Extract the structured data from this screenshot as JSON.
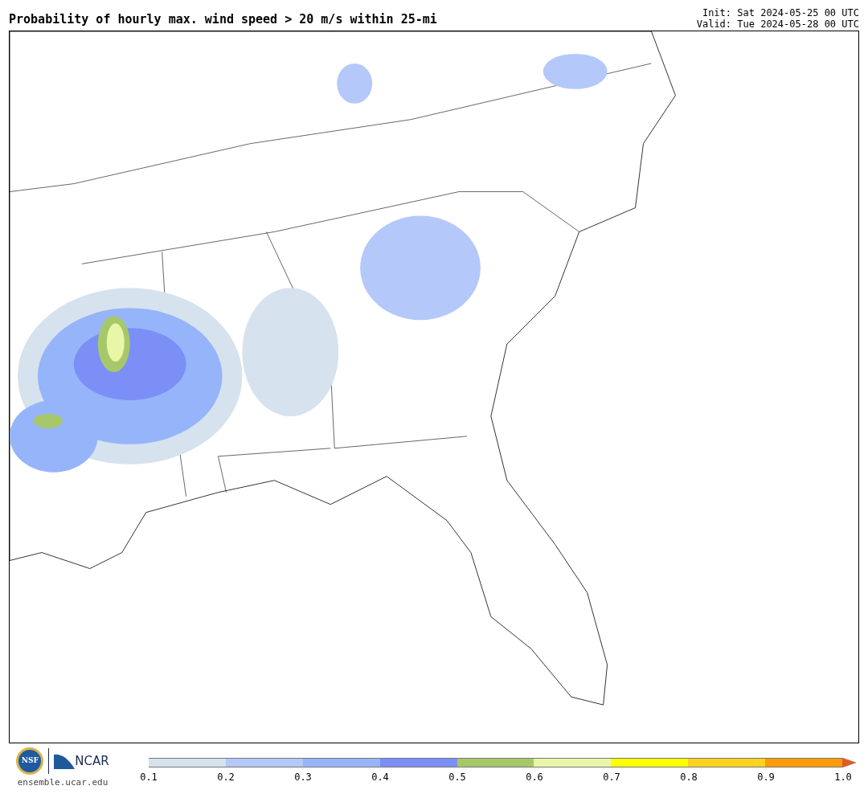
{
  "title": "Probability of hourly max. wind speed > 20 m/s within 25-mi",
  "init": "Init: Sat 2024-05-25 00 UTC",
  "valid": "Valid: Tue 2024-05-28 00 UTC",
  "logos": {
    "nsf": "NSF",
    "ncar": "NCAR",
    "url": "ensemble.ucar.edu"
  },
  "colorbar": {
    "segments": [
      {
        "color": "#d6e2ed"
      },
      {
        "color": "#b4c8fa"
      },
      {
        "color": "#96b4fa"
      },
      {
        "color": "#7b8ff7"
      },
      {
        "color": "#a7c868"
      },
      {
        "color": "#e8f6a8"
      },
      {
        "color": "#ffff00"
      },
      {
        "color": "#ffd21e"
      },
      {
        "color": "#ff9b0a"
      }
    ],
    "extend": {
      "color": "#e8581a"
    },
    "ticks": [
      "0.1",
      "0.2",
      "0.3",
      "0.4",
      "0.5",
      "0.6",
      "0.7",
      "0.8",
      "0.9",
      "1.0"
    ]
  }
}
